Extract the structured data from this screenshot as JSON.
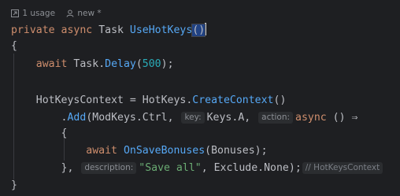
{
  "inlay_meta": {
    "usages": "1 usage",
    "author": "new *"
  },
  "code": {
    "l1": {
      "private": "private",
      "async": "async",
      "task": "Task",
      "name": "UseHotKeys",
      "parens": "()"
    },
    "l2": "{",
    "l3": {
      "await": "await",
      "task": "Task",
      "dot": ".",
      "delay": "Delay",
      "open": "(",
      "num": "500",
      "close": ");"
    },
    "l5": {
      "var": "HotKeysContext",
      "eq": " = ",
      "cls": "HotKeys",
      "dot": ".",
      "method": "CreateContext",
      "tail": "()"
    },
    "l6": {
      "pre": ".",
      "add": "Add",
      "open": "(ModKeys",
      "dot": ".",
      "ctrl": "Ctrl",
      "comma": ", ",
      "hint_key": "key:",
      "keys": "Keys",
      "dot2": ".",
      "a": "A",
      "comma2": ", ",
      "hint_action": "action:",
      "async": "async",
      "arrow": " () ⇒"
    },
    "l7": "{",
    "l8": {
      "await": "await",
      "method": "OnSaveBonuses",
      "args": "(Bonuses);"
    },
    "l9": {
      "close": "}, ",
      "hint_desc": "description:",
      "str": "\"Save all\"",
      "comma": ", ",
      "exclude": "Exclude",
      "dot": ".",
      "none": "None",
      "end": ");",
      "comment": "// HotKeysContext"
    },
    "l10": "}"
  }
}
